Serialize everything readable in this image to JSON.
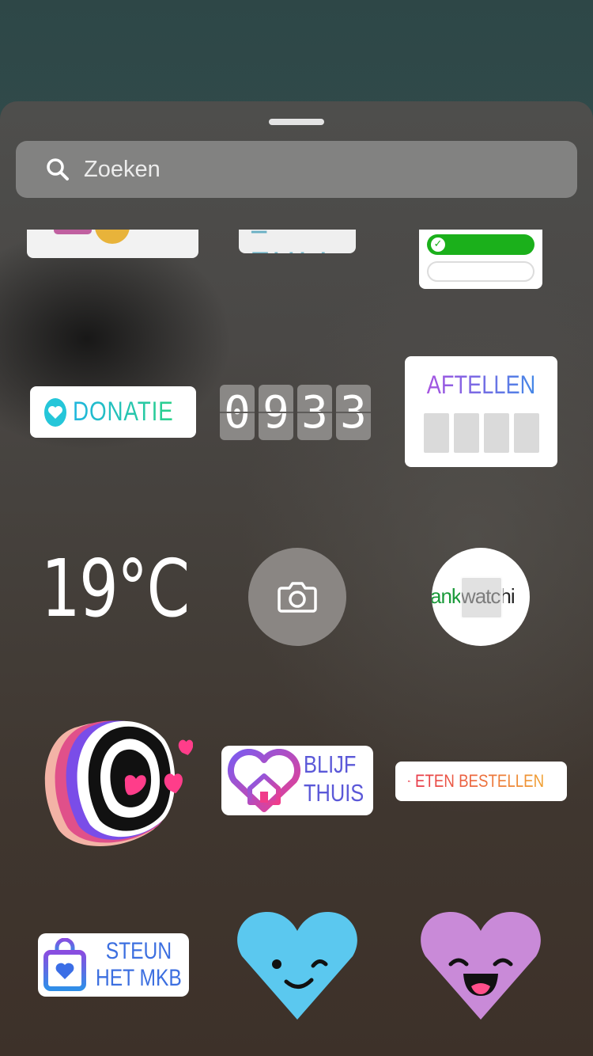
{
  "search": {
    "placeholder": "Zoeken"
  },
  "stickers": {
    "poll_partial": "= FULL",
    "donation": "DONATIE",
    "countdown_time": [
      "0",
      "9",
      "3",
      "3"
    ],
    "countdown_title": "AFTELLEN",
    "temperature": "19°C",
    "link_text_green": "ank",
    "link_text_dark": "watchi",
    "blijf_line1": "BLIJF",
    "blijf_line2": "THUIS",
    "eten": "ETEN BESTELLEN",
    "steun_line1": "STEUN",
    "steun_line2": "HET MKB"
  },
  "colors": {
    "donation_blue": "#25c6d9",
    "countdown_gradient": [
      "#b04ee0",
      "#3b8de8"
    ],
    "heart_blue": "#5bc8ef",
    "heart_purple": "#c98ad8"
  },
  "icons": [
    "search-icon",
    "camera-icon",
    "heart-icon",
    "truck-icon",
    "shopping-bag-icon",
    "house-heart-icon"
  ]
}
